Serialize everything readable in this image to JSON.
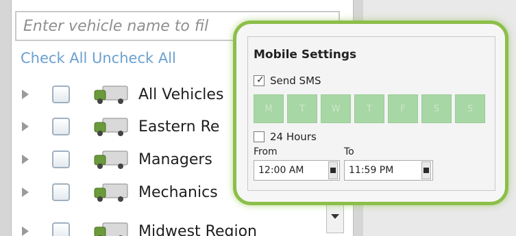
{
  "filter": {
    "placeholder": "Enter vehicle name to fil"
  },
  "links": {
    "check_all": "Check All",
    "uncheck_all": "Uncheck All"
  },
  "tree": {
    "rows": [
      {
        "label": "All Vehicles"
      },
      {
        "label": "Eastern Re"
      },
      {
        "label": "Managers"
      },
      {
        "label": "Mechanics"
      },
      {
        "label": "Midwest Region"
      }
    ]
  },
  "mobile_settings": {
    "title": "Mobile Settings",
    "send_sms": {
      "label": "Send SMS",
      "checked": true
    },
    "days": [
      "M",
      "T",
      "W",
      "T",
      "F",
      "S",
      "S"
    ],
    "hours24": {
      "label": "24 Hours",
      "checked": false
    },
    "from": {
      "label": "From",
      "value": "12:00 AM"
    },
    "to": {
      "label": "To",
      "value": "11:59 PM"
    }
  },
  "colors": {
    "accent_green": "#8cbf4a",
    "day_fill": "#a7d7a4",
    "link_blue": "#6aa0cf"
  },
  "icons": {
    "tree_toggle": "triangle-right-icon",
    "vehicle": "truck-icon",
    "scroll": "chevron-down-icon",
    "time_picker": "clock-icon"
  }
}
